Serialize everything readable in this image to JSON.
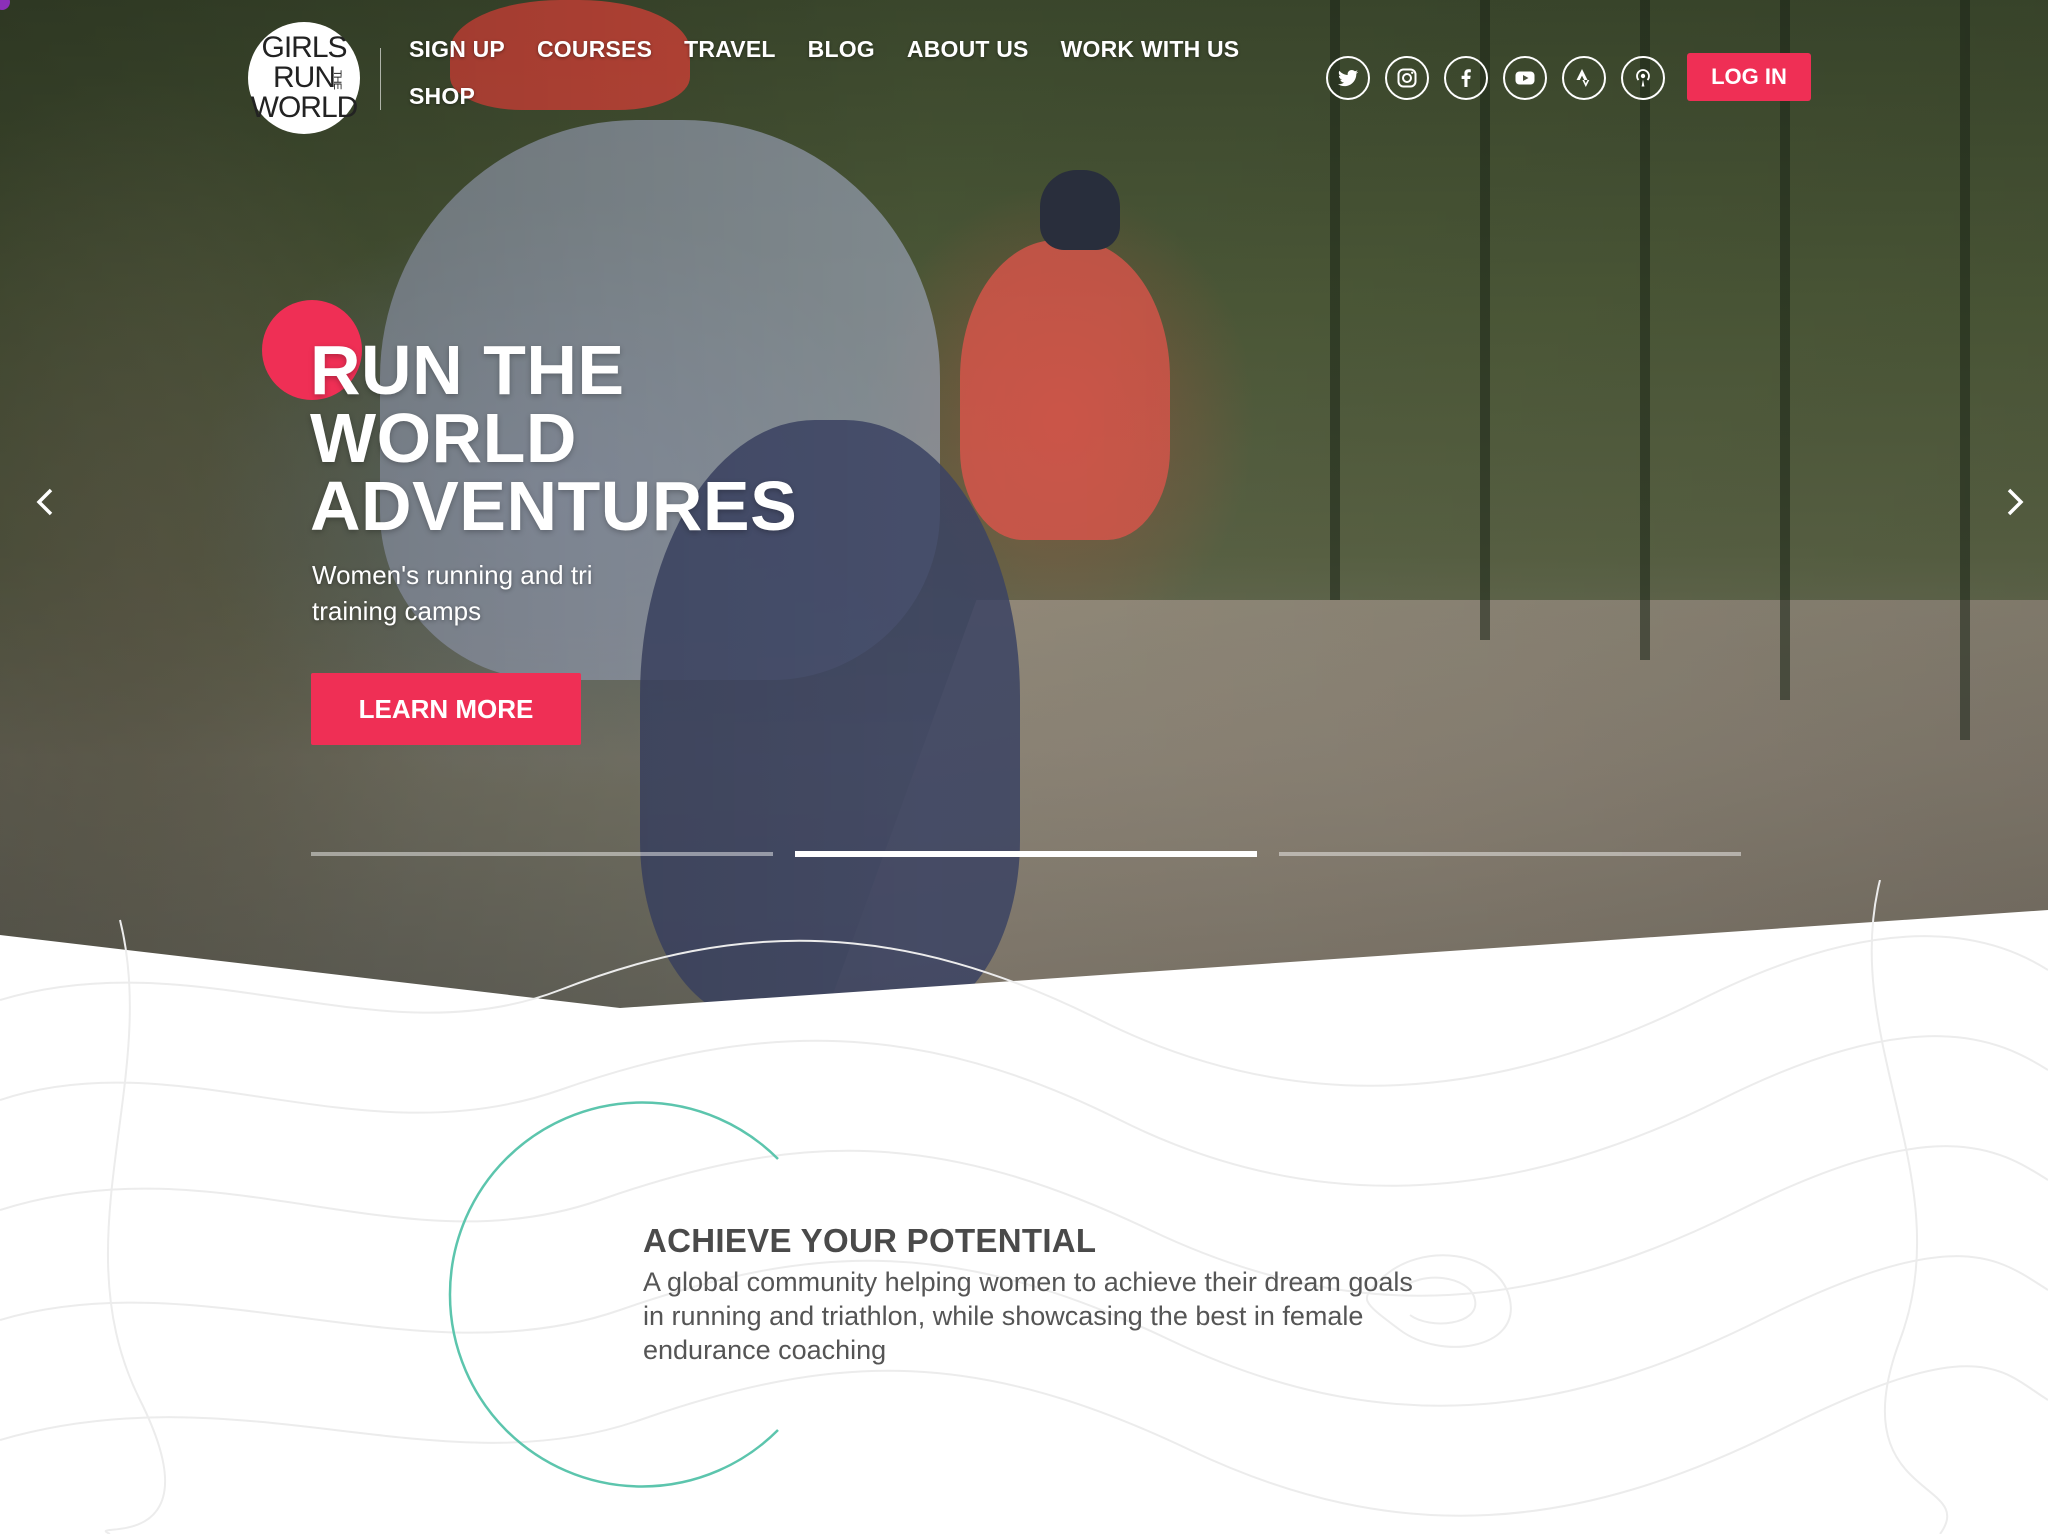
{
  "brand": {
    "logo_lines": [
      "GIRLS",
      "RUN",
      "WORLD"
    ],
    "logo_small": "THE"
  },
  "nav": {
    "items": [
      "SIGN UP",
      "COURSES",
      "TRAVEL",
      "BLOG",
      "ABOUT US",
      "WORK WITH US",
      "SHOP"
    ]
  },
  "social": {
    "icons": [
      "twitter-icon",
      "instagram-icon",
      "facebook-icon",
      "youtube-icon",
      "strava-icon",
      "podcast-icon"
    ]
  },
  "header": {
    "login_label": "LOG IN"
  },
  "hero": {
    "title": "RUN THE\nWORLD\nADVENTURES",
    "subtitle": "Women's running and tri training camps",
    "cta_label": "LEARN MORE",
    "slides_total": 3,
    "active_slide": 2
  },
  "intro": {
    "title": "ACHIEVE YOUR POTENTIAL",
    "body": "A global community helping women to achieve their dream goals in running and triathlon, while showcasing the best in female endurance coaching"
  },
  "colors": {
    "accent": "#ef2f55",
    "ring": "#5cc5ad",
    "heading": "#4a4a4a",
    "body_text": "#555555"
  }
}
